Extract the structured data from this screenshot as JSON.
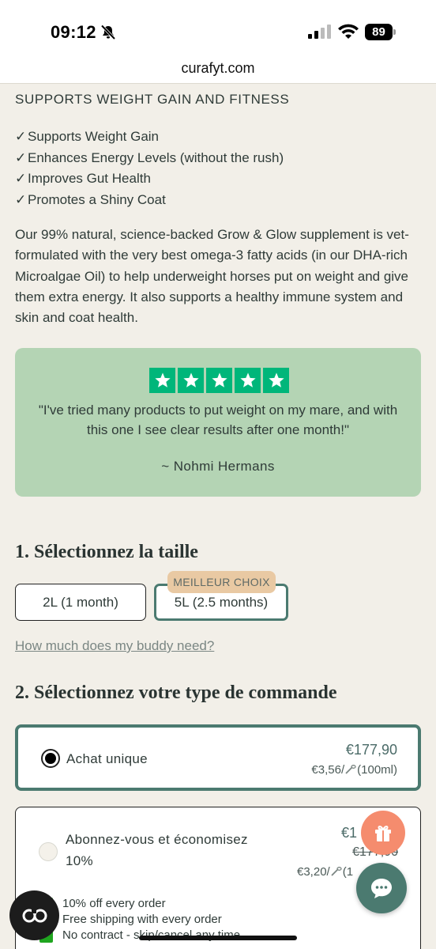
{
  "status_bar": {
    "time": "09:12",
    "battery": "89",
    "icons": [
      "bell-slash-icon",
      "cellular-signal-icon",
      "wifi-icon",
      "battery-icon"
    ]
  },
  "browser": {
    "url": "curafyt.com"
  },
  "product": {
    "heading": "SUPPORTS WEIGHT GAIN AND FITNESS",
    "check_mark": "✓",
    "benefits": [
      "Supports Weight Gain",
      "Enhances Energy Levels (without the rush)",
      "Improves Gut Health",
      "Promotes a Shiny Coat"
    ],
    "description": "Our 99% natural, science-backed Grow & Glow supplement is vet-formulated with the very best omega-3 fatty acids (in our DHA-rich Microalgae Oil) to help underweight horses put on weight and give them extra energy. It also supports a healthy immune system and skin and coat health."
  },
  "review": {
    "rating": 5,
    "rating_max": 5,
    "quote": "\"I've tried many products to put weight on my mare, and with this one I see clear results after one month!\"",
    "author": "~ Nohmi Hermans",
    "star_color": "#00b67a",
    "background": "#b4d4b4"
  },
  "size_step": {
    "title": "1. Sélectionnez la taille",
    "options": [
      {
        "label": "2L (1 month)",
        "selected": false
      },
      {
        "label": "5L (2.5 months)",
        "selected": true,
        "badge": "MEILLEUR CHOIX"
      }
    ],
    "help_link": "How much does my buddy need?"
  },
  "order_step": {
    "title": "2. Sélectionnez votre type de commande",
    "one_time": {
      "label": "Achat unique",
      "price": "€177,90",
      "unit_price": "€3,56/",
      "unit_suffix": "(100ml)",
      "selected": true
    },
    "subscription": {
      "label_line1": "Abonnez-vous et économisez",
      "label_line2": "10%",
      "price_partial": "€1",
      "old_price_partial": "€177,90",
      "unit_price": "€3,20/",
      "unit_suffix_partial": "(1",
      "selected": false,
      "perks": [
        "10% off every order",
        "Free shipping with every order",
        "No contract - skip/cancel any time"
      ]
    }
  },
  "floating": {
    "co_label": "CO",
    "accent": "#4b7a70",
    "gift_color": "#f58c6e"
  }
}
